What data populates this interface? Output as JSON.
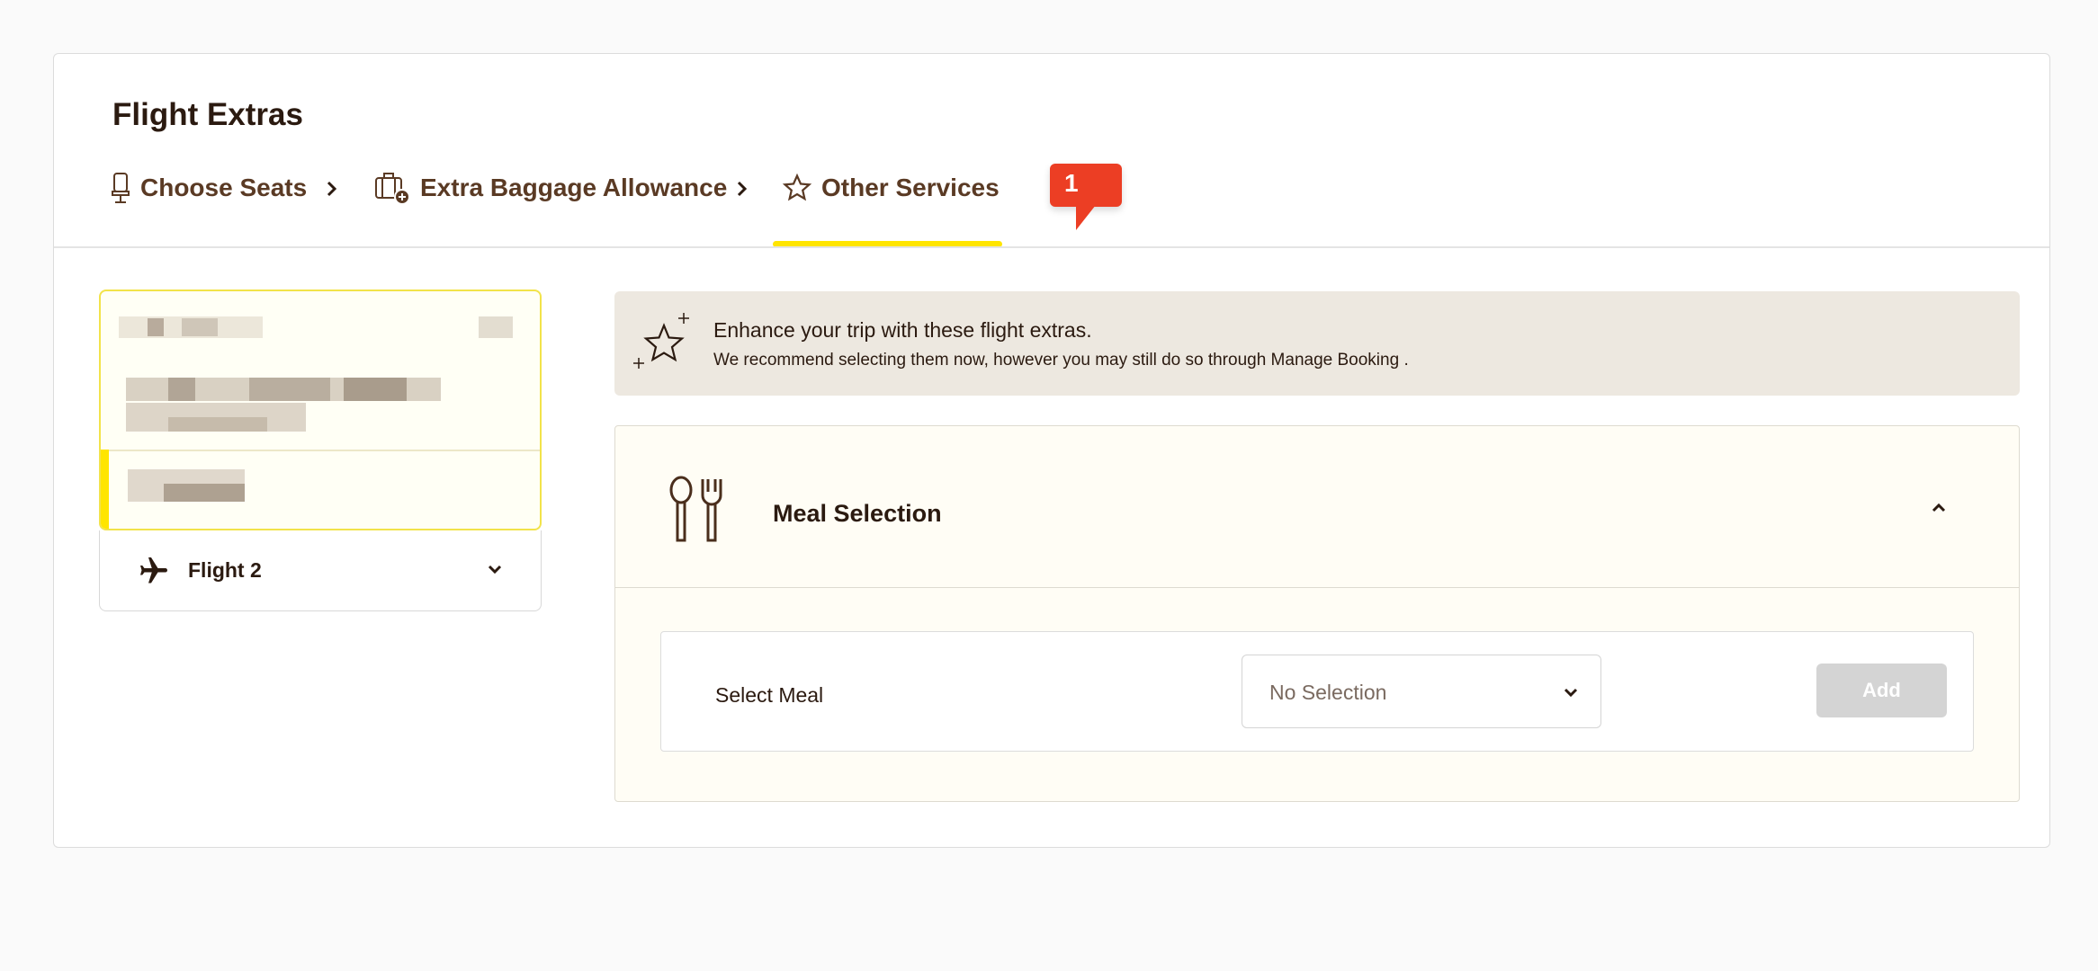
{
  "page": {
    "title": "Flight Extras"
  },
  "tabs": [
    {
      "label": "Choose Seats",
      "icon": "seat-icon"
    },
    {
      "label": "Extra Baggage Allowance",
      "icon": "baggage-add-icon"
    },
    {
      "label": "Other Services",
      "icon": "star-icon",
      "active": true
    }
  ],
  "badge": {
    "count": "1"
  },
  "flights": {
    "flight2": {
      "label": "Flight 2",
      "icon": "airplane-icon"
    }
  },
  "banner": {
    "heading": "Enhance your trip with these flight extras.",
    "subtext": "We recommend selecting them now, however you may still do so through Manage Booking ."
  },
  "meal": {
    "title": "Meal Selection",
    "select_label": "Select Meal",
    "selected_value": "No Selection",
    "add_label": "Add"
  },
  "colors": {
    "accent_yellow": "#ffe500",
    "badge_red": "#ec3e24",
    "text_brown": "#2b1a10",
    "tab_brown": "#5a3a24",
    "banner_bg": "#ede8e0"
  }
}
